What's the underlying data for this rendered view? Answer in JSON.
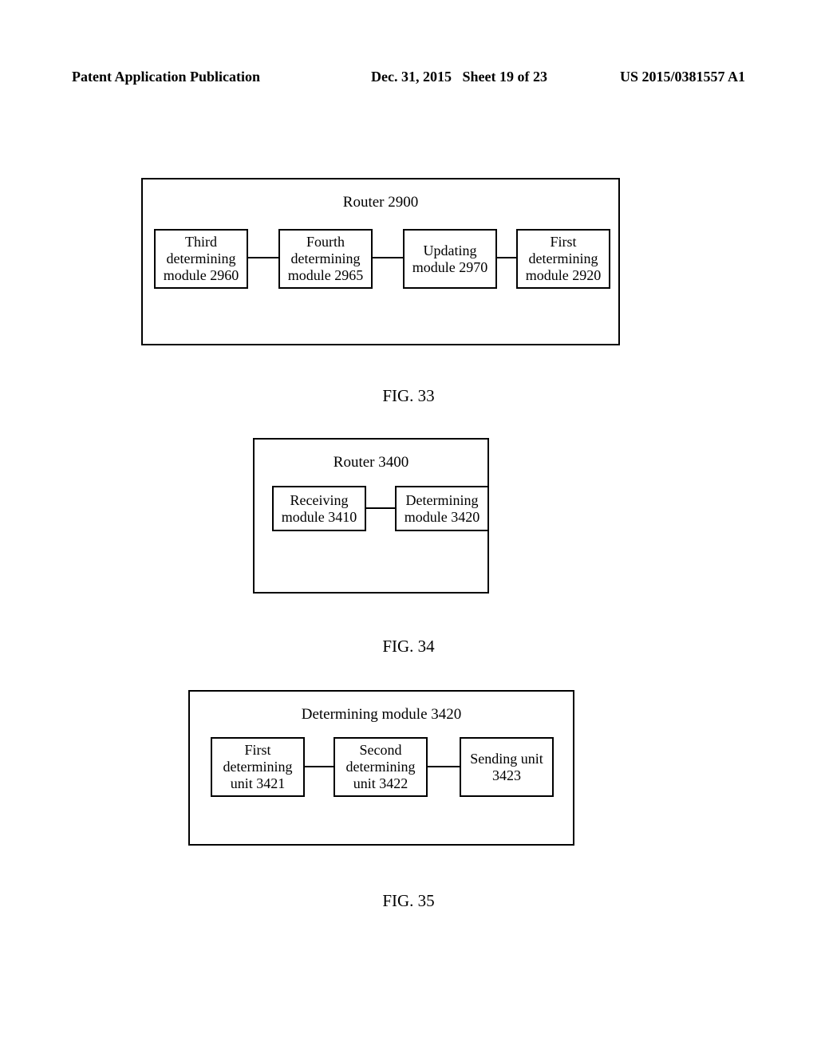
{
  "header": {
    "left": "Patent Application Publication",
    "date": "Dec. 31, 2015",
    "sheet": "Sheet 19 of 23",
    "pubno": "US 2015/0381557 A1"
  },
  "fig33": {
    "caption": "FIG. 33",
    "title": "Router 2900",
    "boxes": [
      "Third determining module 2960",
      "Fourth determining module 2965",
      "Updating module 2970",
      "First determining module 2920"
    ]
  },
  "fig34": {
    "caption": "FIG. 34",
    "title": "Router 3400",
    "boxes": [
      "Receiving module 3410",
      "Determining module 3420"
    ]
  },
  "fig35": {
    "caption": "FIG. 35",
    "title": "Determining module 3420",
    "boxes": [
      "First determining unit 3421",
      "Second determining unit 3422",
      "Sending unit 3423"
    ]
  },
  "chart_data": [
    {
      "type": "diagram",
      "title": "Router 2900",
      "nodes": [
        {
          "id": "2960",
          "label": "Third determining module 2960"
        },
        {
          "id": "2965",
          "label": "Fourth determining module 2965"
        },
        {
          "id": "2970",
          "label": "Updating module 2970"
        },
        {
          "id": "2920",
          "label": "First determining module 2920"
        }
      ],
      "edges": [
        [
          "2960",
          "2965"
        ],
        [
          "2965",
          "2970"
        ],
        [
          "2970",
          "2920"
        ]
      ]
    },
    {
      "type": "diagram",
      "title": "Router 3400",
      "nodes": [
        {
          "id": "3410",
          "label": "Receiving module 3410"
        },
        {
          "id": "3420",
          "label": "Determining module 3420"
        }
      ],
      "edges": [
        [
          "3410",
          "3420"
        ]
      ]
    },
    {
      "type": "diagram",
      "title": "Determining module 3420",
      "nodes": [
        {
          "id": "3421",
          "label": "First determining unit 3421"
        },
        {
          "id": "3422",
          "label": "Second determining unit 3422"
        },
        {
          "id": "3423",
          "label": "Sending unit 3423"
        }
      ],
      "edges": [
        [
          "3421",
          "3422"
        ],
        [
          "3422",
          "3423"
        ]
      ]
    }
  ]
}
